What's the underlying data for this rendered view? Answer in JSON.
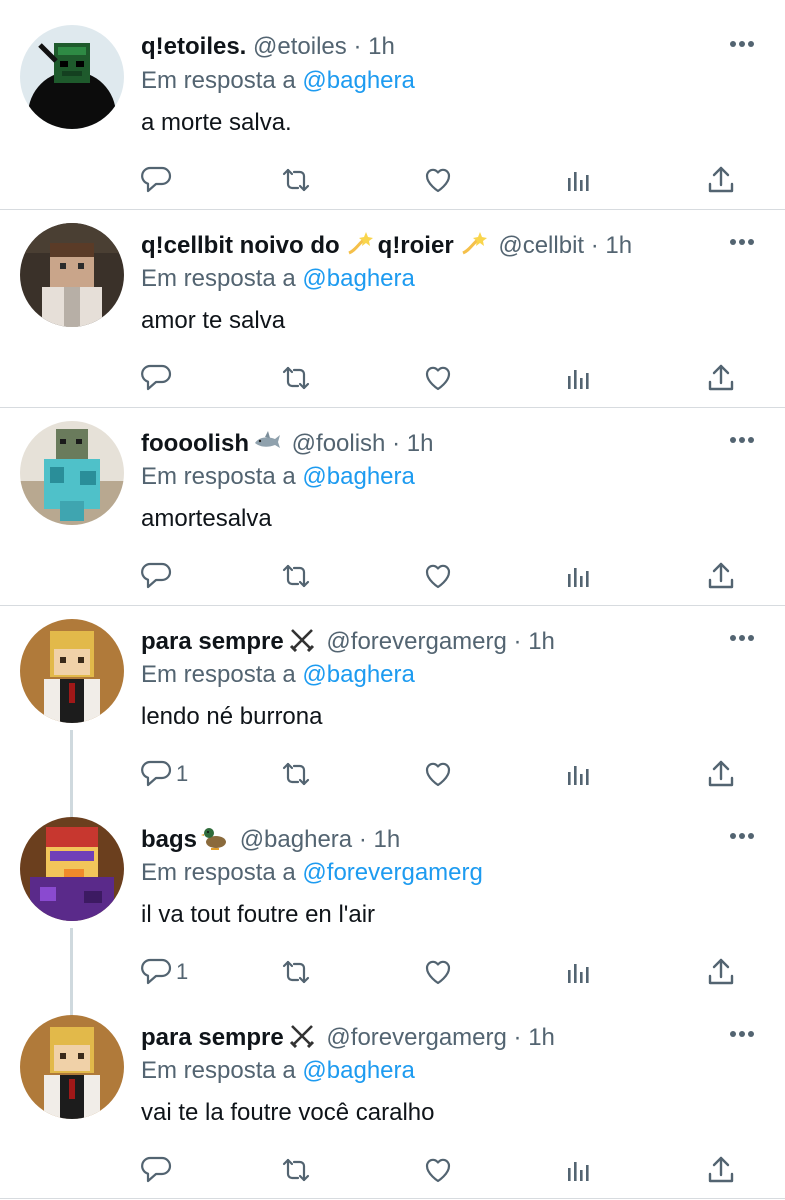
{
  "reply_prefix": "Em resposta a",
  "colors": {
    "text": "#0f1419",
    "secondary": "#536471",
    "mention": "#1d9bf0",
    "separator": "#d7dbdf",
    "thread_line": "#cfd9de"
  },
  "tweets": [
    {
      "name": "q!etoiles.",
      "handle": "@etoiles",
      "time": "1h",
      "reply_to": "@baghera",
      "text": "a morte salva.",
      "reply_count": ""
    },
    {
      "name_part1": "q!cellbit noivo do",
      "name_part2": "q!roier",
      "emoji": "dizzy-emoji",
      "handle": "@cellbit",
      "time": "1h",
      "reply_to": "@baghera",
      "text": "amor te salva",
      "reply_count": ""
    },
    {
      "name": "foooolish",
      "emoji": "shark-emoji",
      "handle": "@foolish",
      "time": "1h",
      "reply_to": "@baghera",
      "text": "amortesalva",
      "reply_count": ""
    },
    {
      "name": "para sempre",
      "emoji": "crossed-swords-emoji",
      "handle": "@forevergamerg",
      "time": "1h",
      "reply_to": "@baghera",
      "text": "lendo né burrona",
      "reply_count": "1"
    },
    {
      "name": "bags",
      "emoji": "duck-emoji",
      "handle": "@baghera",
      "time": "1h",
      "reply_to": "@forevergamerg",
      "text": "il va tout foutre en l'air",
      "reply_count": "1"
    },
    {
      "name": "para sempre",
      "emoji": "crossed-swords-emoji",
      "handle": "@forevergamerg",
      "time": "1h",
      "reply_to": "@baghera",
      "text": "vai te la foutre você caralho",
      "reply_count": ""
    }
  ],
  "icons": [
    "reply-icon",
    "retweet-icon",
    "like-icon",
    "views-icon",
    "share-icon",
    "more-options-icon"
  ]
}
